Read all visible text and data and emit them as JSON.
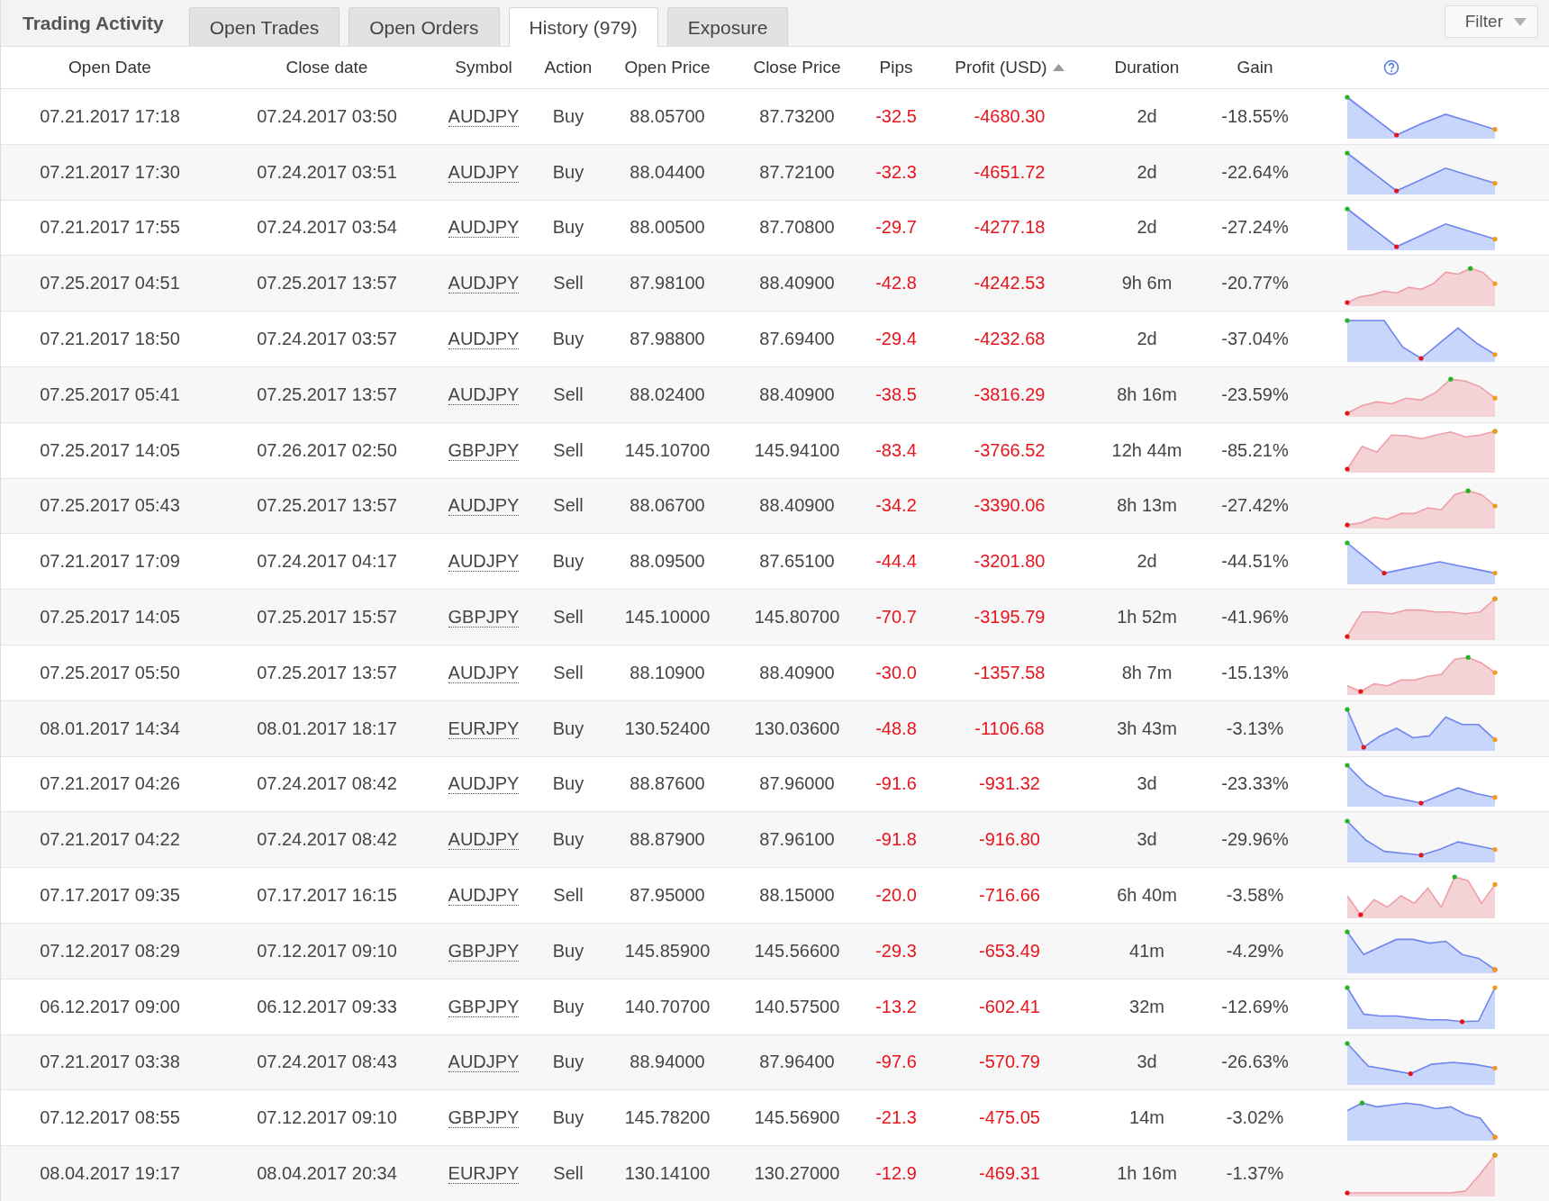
{
  "title": "Trading Activity",
  "tabs": [
    {
      "label": "Open Trades",
      "selected": false
    },
    {
      "label": "Open Orders",
      "selected": false
    },
    {
      "label": "History (979)",
      "selected": true
    },
    {
      "label": "Exposure",
      "selected": false
    }
  ],
  "filter": {
    "label": "Filter"
  },
  "columns": [
    {
      "label": "Open Date",
      "sorted": false
    },
    {
      "label": "Close date",
      "sorted": false
    },
    {
      "label": "Symbol",
      "sorted": false
    },
    {
      "label": "Action",
      "sorted": false
    },
    {
      "label": "Open Price",
      "sorted": false
    },
    {
      "label": "Close Price",
      "sorted": false
    },
    {
      "label": "Pips",
      "sorted": false
    },
    {
      "label": "Profit (USD)",
      "sorted": true
    },
    {
      "label": "Duration",
      "sorted": false
    },
    {
      "label": "Gain",
      "sorted": false
    }
  ],
  "rows": [
    {
      "open_date": "07.21.2017 17:18",
      "close_date": "07.24.2017 03:50",
      "symbol": "AUDJPY",
      "action": "Buy",
      "open_price": "88.05700",
      "close_price": "87.73200",
      "pips": "-32.5",
      "profit": "-4680.30",
      "duration": "2d",
      "gain": "-18.55%"
    },
    {
      "open_date": "07.21.2017 17:30",
      "close_date": "07.24.2017 03:51",
      "symbol": "AUDJPY",
      "action": "Buy",
      "open_price": "88.04400",
      "close_price": "87.72100",
      "pips": "-32.3",
      "profit": "-4651.72",
      "duration": "2d",
      "gain": "-22.64%"
    },
    {
      "open_date": "07.21.2017 17:55",
      "close_date": "07.24.2017 03:54",
      "symbol": "AUDJPY",
      "action": "Buy",
      "open_price": "88.00500",
      "close_price": "87.70800",
      "pips": "-29.7",
      "profit": "-4277.18",
      "duration": "2d",
      "gain": "-27.24%"
    },
    {
      "open_date": "07.25.2017 04:51",
      "close_date": "07.25.2017 13:57",
      "symbol": "AUDJPY",
      "action": "Sell",
      "open_price": "87.98100",
      "close_price": "88.40900",
      "pips": "-42.8",
      "profit": "-4242.53",
      "duration": "9h 6m",
      "gain": "-20.77%"
    },
    {
      "open_date": "07.21.2017 18:50",
      "close_date": "07.24.2017 03:57",
      "symbol": "AUDJPY",
      "action": "Buy",
      "open_price": "87.98800",
      "close_price": "87.69400",
      "pips": "-29.4",
      "profit": "-4232.68",
      "duration": "2d",
      "gain": "-37.04%"
    },
    {
      "open_date": "07.25.2017 05:41",
      "close_date": "07.25.2017 13:57",
      "symbol": "AUDJPY",
      "action": "Sell",
      "open_price": "88.02400",
      "close_price": "88.40900",
      "pips": "-38.5",
      "profit": "-3816.29",
      "duration": "8h 16m",
      "gain": "-23.59%"
    },
    {
      "open_date": "07.25.2017 14:05",
      "close_date": "07.26.2017 02:50",
      "symbol": "GBPJPY",
      "action": "Sell",
      "open_price": "145.10700",
      "close_price": "145.94100",
      "pips": "-83.4",
      "profit": "-3766.52",
      "duration": "12h 44m",
      "gain": "-85.21%"
    },
    {
      "open_date": "07.25.2017 05:43",
      "close_date": "07.25.2017 13:57",
      "symbol": "AUDJPY",
      "action": "Sell",
      "open_price": "88.06700",
      "close_price": "88.40900",
      "pips": "-34.2",
      "profit": "-3390.06",
      "duration": "8h 13m",
      "gain": "-27.42%"
    },
    {
      "open_date": "07.21.2017 17:09",
      "close_date": "07.24.2017 04:17",
      "symbol": "AUDJPY",
      "action": "Buy",
      "open_price": "88.09500",
      "close_price": "87.65100",
      "pips": "-44.4",
      "profit": "-3201.80",
      "duration": "2d",
      "gain": "-44.51%"
    },
    {
      "open_date": "07.25.2017 14:05",
      "close_date": "07.25.2017 15:57",
      "symbol": "GBPJPY",
      "action": "Sell",
      "open_price": "145.10000",
      "close_price": "145.80700",
      "pips": "-70.7",
      "profit": "-3195.79",
      "duration": "1h 52m",
      "gain": "-41.96%"
    },
    {
      "open_date": "07.25.2017 05:50",
      "close_date": "07.25.2017 13:57",
      "symbol": "AUDJPY",
      "action": "Sell",
      "open_price": "88.10900",
      "close_price": "88.40900",
      "pips": "-30.0",
      "profit": "-1357.58",
      "duration": "8h 7m",
      "gain": "-15.13%"
    },
    {
      "open_date": "08.01.2017 14:34",
      "close_date": "08.01.2017 18:17",
      "symbol": "EURJPY",
      "action": "Buy",
      "open_price": "130.52400",
      "close_price": "130.03600",
      "pips": "-48.8",
      "profit": "-1106.68",
      "duration": "3h 43m",
      "gain": "-3.13%"
    },
    {
      "open_date": "07.21.2017 04:26",
      "close_date": "07.24.2017 08:42",
      "symbol": "AUDJPY",
      "action": "Buy",
      "open_price": "88.87600",
      "close_price": "87.96000",
      "pips": "-91.6",
      "profit": "-931.32",
      "duration": "3d",
      "gain": "-23.33%"
    },
    {
      "open_date": "07.21.2017 04:22",
      "close_date": "07.24.2017 08:42",
      "symbol": "AUDJPY",
      "action": "Buy",
      "open_price": "88.87900",
      "close_price": "87.96100",
      "pips": "-91.8",
      "profit": "-916.80",
      "duration": "3d",
      "gain": "-29.96%"
    },
    {
      "open_date": "07.17.2017 09:35",
      "close_date": "07.17.2017 16:15",
      "symbol": "AUDJPY",
      "action": "Sell",
      "open_price": "87.95000",
      "close_price": "88.15000",
      "pips": "-20.0",
      "profit": "-716.66",
      "duration": "6h 40m",
      "gain": "-3.58%"
    },
    {
      "open_date": "07.12.2017 08:29",
      "close_date": "07.12.2017 09:10",
      "symbol": "GBPJPY",
      "action": "Buy",
      "open_price": "145.85900",
      "close_price": "145.56600",
      "pips": "-29.3",
      "profit": "-653.49",
      "duration": "41m",
      "gain": "-4.29%"
    },
    {
      "open_date": "06.12.2017 09:00",
      "close_date": "06.12.2017 09:33",
      "symbol": "GBPJPY",
      "action": "Buy",
      "open_price": "140.70700",
      "close_price": "140.57500",
      "pips": "-13.2",
      "profit": "-602.41",
      "duration": "32m",
      "gain": "-12.69%"
    },
    {
      "open_date": "07.21.2017 03:38",
      "close_date": "07.24.2017 08:43",
      "symbol": "AUDJPY",
      "action": "Buy",
      "open_price": "88.94000",
      "close_price": "87.96400",
      "pips": "-97.6",
      "profit": "-570.79",
      "duration": "3d",
      "gain": "-26.63%"
    },
    {
      "open_date": "07.12.2017 08:55",
      "close_date": "07.12.2017 09:10",
      "symbol": "GBPJPY",
      "action": "Buy",
      "open_price": "145.78200",
      "close_price": "145.56900",
      "pips": "-21.3",
      "profit": "-475.05",
      "duration": "14m",
      "gain": "-3.02%"
    },
    {
      "open_date": "08.04.2017 19:17",
      "close_date": "08.04.2017 20:34",
      "symbol": "EURJPY",
      "action": "Sell",
      "open_price": "130.14100",
      "close_price": "130.27000",
      "pips": "-12.9",
      "profit": "-469.31",
      "duration": "1h 16m",
      "gain": "-1.37%"
    }
  ]
}
